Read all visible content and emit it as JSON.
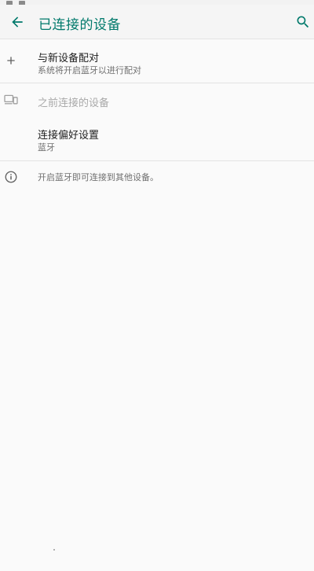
{
  "colors": {
    "accent": "#00796b",
    "background": "#fafafa",
    "divider": "#e2e2e2",
    "secondary_text": "#6f6f6f",
    "disabled_text": "#a9a9a9"
  },
  "header": {
    "title": "已连接的设备",
    "back_icon": "arrow-back-icon",
    "search_icon": "search-icon"
  },
  "pair_new": {
    "icon": "plus-icon",
    "title": "与新设备配对",
    "subtitle": "系统将开启蓝牙以进行配对"
  },
  "previous_devices": {
    "icon": "devices-icon",
    "title": "之前连接的设备"
  },
  "connection_prefs": {
    "title": "连接偏好设置",
    "subtitle": "蓝牙"
  },
  "info": {
    "icon": "info-icon",
    "text": "开启蓝牙即可连接到其他设备。"
  }
}
